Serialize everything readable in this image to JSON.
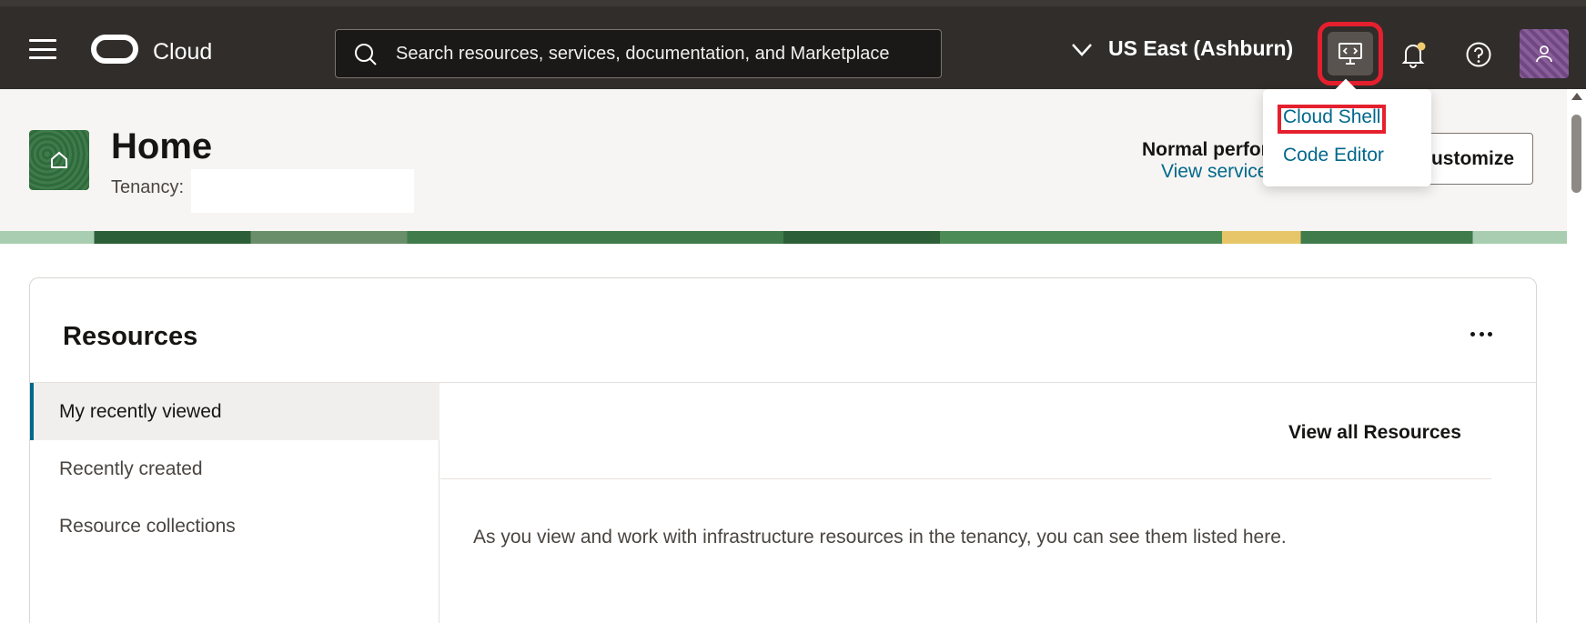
{
  "header": {
    "brand": "Cloud",
    "search": {
      "placeholder": "Search resources, services, documentation, and Marketplace"
    },
    "region": "US East (Ashburn)"
  },
  "page": {
    "title": "Home",
    "tenancy_label": "Tenancy:",
    "status_title": "Normal performance",
    "status_link": "View service health",
    "customize_label": "Customize"
  },
  "developer_menu": {
    "items": [
      "Cloud Shell",
      "Code Editor"
    ]
  },
  "resources": {
    "title": "Resources",
    "tabs": [
      "My recently viewed",
      "Recently created",
      "Resource collections"
    ],
    "view_all": "View all Resources",
    "empty_message": "As you view and work with infrastructure resources in the tenancy, you can see them listed here."
  },
  "colors": {
    "accent_link": "#00688c",
    "highlight": "#e5202e",
    "header_bg": "#312d2a"
  }
}
